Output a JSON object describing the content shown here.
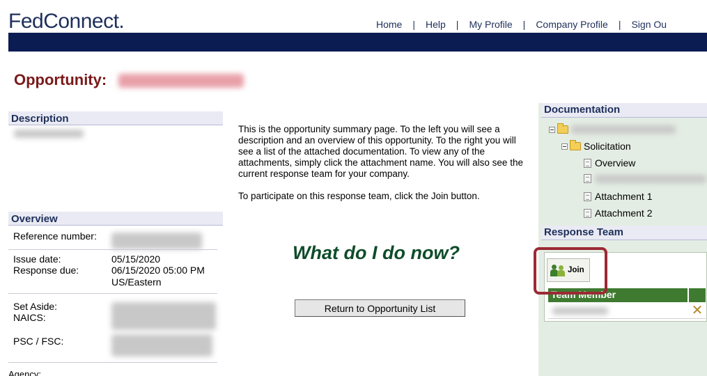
{
  "header": {
    "logo": "FedConnect.",
    "nav": [
      {
        "label": "Home"
      },
      {
        "label": "Help"
      },
      {
        "label": "My Profile"
      },
      {
        "label": "Company Profile"
      },
      {
        "label": "Sign Ou"
      }
    ],
    "separator": "|"
  },
  "page": {
    "title": "Opportunity:"
  },
  "left": {
    "description_header": "Description",
    "overview_header": "Overview",
    "fields": {
      "reference_label": "Reference number:",
      "issue_label": "Issue date:",
      "issue_value": "05/15/2020",
      "response_label": "Response due:",
      "response_value_1": "06/15/2020 05:00 PM",
      "response_value_2": "US/Eastern",
      "setaside_label": "Set Aside:",
      "naics_label": "NAICS:",
      "psc_label": "PSC / FSC:",
      "agency_label": "Agency:"
    }
  },
  "middle": {
    "intro_p1": "This is the opportunity summary page. To the left you will see a description and an overview of this opportunity. To the right you will see a list of the attached documentation. To view any of the attachments, simply click the attachment name. You will also see the current response team for your company.",
    "intro_p2": "To participate on this response team, click the Join button.",
    "what_now": "What do I do now?",
    "return_button": "Return to Opportunity List"
  },
  "right": {
    "documentation_header": "Documentation",
    "tree": {
      "solicitation": "Solicitation",
      "overview": "Overview",
      "attachment1": "Attachment 1",
      "attachment2": "Attachment 2"
    },
    "response_team_header": "Response Team",
    "join_button": "Join",
    "team_column": "Team Member",
    "remove_glyph": "✕"
  },
  "colors": {
    "brand_navy": "#0b1c53",
    "title_red": "#7a1a1a",
    "team_green": "#3f7a31",
    "highlight": "#9b2a35"
  }
}
